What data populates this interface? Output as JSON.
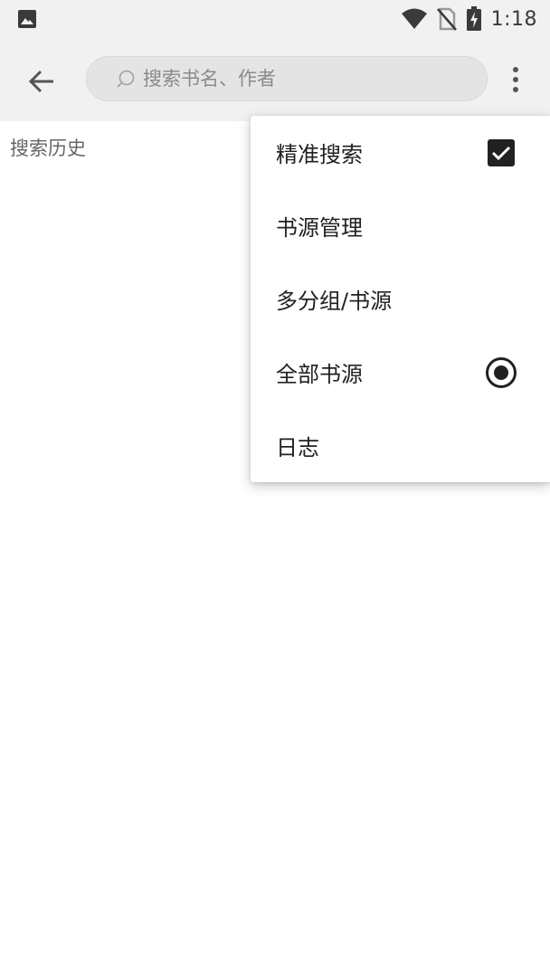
{
  "status_bar": {
    "time": "1:18",
    "icons": [
      "gallery-icon",
      "wifi-icon",
      "no-sim-icon",
      "battery-charging-icon"
    ]
  },
  "toolbar": {
    "back_icon": "arrow-left-icon",
    "search": {
      "placeholder": "搜索书名、作者",
      "value": ""
    },
    "more_icon": "more-vertical-icon"
  },
  "content": {
    "history_label": "搜索历史"
  },
  "menu": {
    "items": [
      {
        "label": "精准搜索",
        "control": "checkbox",
        "checked": true
      },
      {
        "label": "书源管理",
        "control": "none"
      },
      {
        "label": "多分组/书源",
        "control": "none"
      },
      {
        "label": "全部书源",
        "control": "radio",
        "checked": true
      },
      {
        "label": "日志",
        "control": "none"
      }
    ]
  },
  "colors": {
    "toolbar_bg": "#f1f1f1",
    "search_bg": "#e4e4e4",
    "menu_text": "#212121",
    "history_text": "#666666"
  }
}
